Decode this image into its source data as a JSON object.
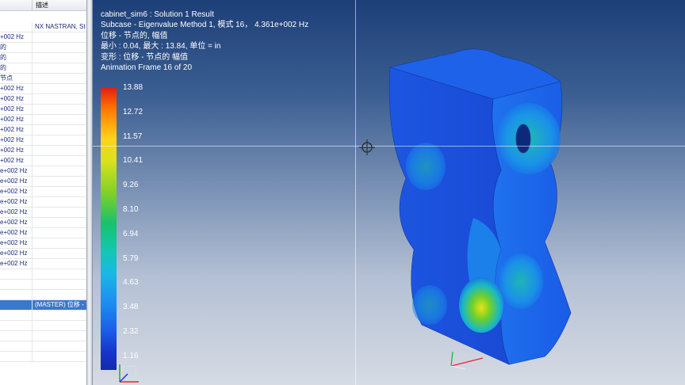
{
  "navigator": {
    "col_header": "描述",
    "rows": [
      {
        "c1": "",
        "c2": "NX NASTRAN, St"
      },
      {
        "c1": "+002 Hz",
        "c2": ""
      },
      {
        "c1": "的",
        "c2": ""
      },
      {
        "c1": "的",
        "c2": ""
      },
      {
        "c1": "的",
        "c2": ""
      },
      {
        "c1": "节点",
        "c2": ""
      },
      {
        "c1": "+002 Hz",
        "c2": ""
      },
      {
        "c1": "+002 Hz",
        "c2": ""
      },
      {
        "c1": "+002 Hz",
        "c2": ""
      },
      {
        "c1": "+002 Hz",
        "c2": ""
      },
      {
        "c1": "+002 Hz",
        "c2": ""
      },
      {
        "c1": "+002 Hz",
        "c2": ""
      },
      {
        "c1": "+002 Hz",
        "c2": ""
      },
      {
        "c1": "+002 Hz",
        "c2": ""
      },
      {
        "c1": "e+002 Hz",
        "c2": ""
      },
      {
        "c1": "e+002 Hz",
        "c2": ""
      },
      {
        "c1": "e+002 Hz",
        "c2": ""
      },
      {
        "c1": "e+002 Hz",
        "c2": ""
      },
      {
        "c1": "e+002 Hz",
        "c2": ""
      },
      {
        "c1": "e+002 Hz",
        "c2": ""
      },
      {
        "c1": "e+002 Hz",
        "c2": ""
      },
      {
        "c1": "e+002 Hz",
        "c2": ""
      },
      {
        "c1": "e+002 Hz",
        "c2": ""
      },
      {
        "c1": "e+002 Hz",
        "c2": ""
      },
      {
        "c1": "",
        "c2": ""
      },
      {
        "c1": "",
        "c2": ""
      },
      {
        "c1": "",
        "c2": ""
      },
      {
        "c1": "",
        "c2": "(MASTER) 位移 - 节"
      },
      {
        "c1": "",
        "c2": ""
      },
      {
        "c1": "",
        "c2": ""
      },
      {
        "c1": "",
        "c2": ""
      },
      {
        "c1": "",
        "c2": ""
      },
      {
        "c1": "",
        "c2": ""
      }
    ],
    "selected_index": 27
  },
  "viewport": {
    "info_lines": [
      "cabinet_sim6 : Solution 1 Result",
      "Subcase - Eigenvalue Method 1, 模式 16，  4.361e+002 Hz",
      "位移 - 节点的, 幅值",
      "最小 : 0.04, 最大 : 13.84, 单位 = in",
      "变形 : 位移 - 节点的 幅值",
      "Animation Frame 16 of 20"
    ],
    "legend_values": [
      "13.88",
      "12.72",
      "11.57",
      "10.41",
      "9.26",
      "8.10",
      "6.94",
      "5.79",
      "4.63",
      "3.48",
      "2.32",
      "1.16"
    ],
    "legend_colors": [
      "#e51b0f",
      "#ff7a00",
      "#ffd21a",
      "#d9e21b",
      "#7bcf2a",
      "#18c26b",
      "#14c7b2",
      "#1ab7e6",
      "#1c8ff0",
      "#1a5fe8",
      "#1534c9",
      "#1529b0"
    ]
  }
}
